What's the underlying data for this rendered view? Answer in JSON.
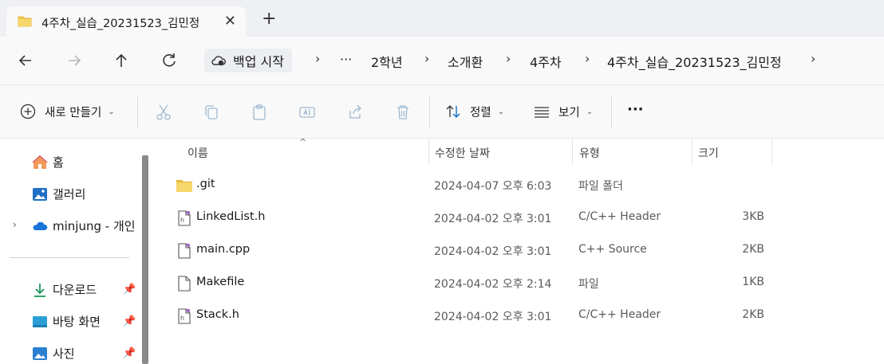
{
  "tab": {
    "title": "4주차_실습_20231523_김민정",
    "close": "✕",
    "new": "+"
  },
  "nav": {
    "back_icon": "back-arrow-icon",
    "forward_icon": "forward-arrow-icon",
    "up_icon": "up-arrow-icon",
    "refresh_icon": "refresh-icon"
  },
  "address": {
    "backup_label": "백업 시작",
    "overflow": "···",
    "separator": "›",
    "crumbs": [
      "2학년",
      "소개환",
      "4주차",
      "4주차_실습_20231523_김민정"
    ]
  },
  "toolbar": {
    "new_label": "새로 만들기",
    "sort_label": "정렬",
    "view_label": "보기",
    "more": "···",
    "chevron": "⌄",
    "disabled_icons": [
      "cut-icon",
      "copy-icon",
      "paste-icon",
      "rename-icon",
      "share-icon",
      "delete-icon"
    ]
  },
  "sidebar": {
    "items": [
      {
        "label": "홈",
        "icon": "home-icon"
      },
      {
        "label": "갤러리",
        "icon": "gallery-icon"
      },
      {
        "label": "minjung - 개인",
        "icon": "onedrive-cloud-icon"
      },
      {
        "label": "다운로드",
        "icon": "download-icon",
        "pinned": true
      },
      {
        "label": "바탕 화면",
        "icon": "desktop-icon",
        "pinned": true
      },
      {
        "label": "사진",
        "icon": "pictures-icon",
        "pinned": true
      }
    ],
    "expander": "›",
    "pin": "📌"
  },
  "columns": {
    "name": "이름",
    "modified": "수정한 날짜",
    "type": "유형",
    "size": "크기",
    "sort_indicator": "^"
  },
  "files": [
    {
      "name": ".git",
      "modified": "2024-04-07 오후 6:03",
      "type": "파일 폴더",
      "size": "",
      "icon": "folder-icon"
    },
    {
      "name": "LinkedList.h",
      "modified": "2024-04-02 오후 3:01",
      "type": "C/C++ Header",
      "size": "3KB",
      "icon": "header-file-icon"
    },
    {
      "name": "main.cpp",
      "modified": "2024-04-02 오후 3:01",
      "type": "C++ Source",
      "size": "2KB",
      "icon": "cpp-file-icon"
    },
    {
      "name": "Makefile",
      "modified": "2024-04-02 오후 2:14",
      "type": "파일",
      "size": "1KB",
      "icon": "file-icon"
    },
    {
      "name": "Stack.h",
      "modified": "2024-04-02 오후 3:01",
      "type": "C/C++ Header",
      "size": "2KB",
      "icon": "header-file-icon"
    }
  ],
  "colors": {
    "tabstrip_bg": "#eef0f3",
    "folder": "#f2c94c",
    "accent": "#0067c0",
    "scrollbar": "#8a8a8a"
  }
}
